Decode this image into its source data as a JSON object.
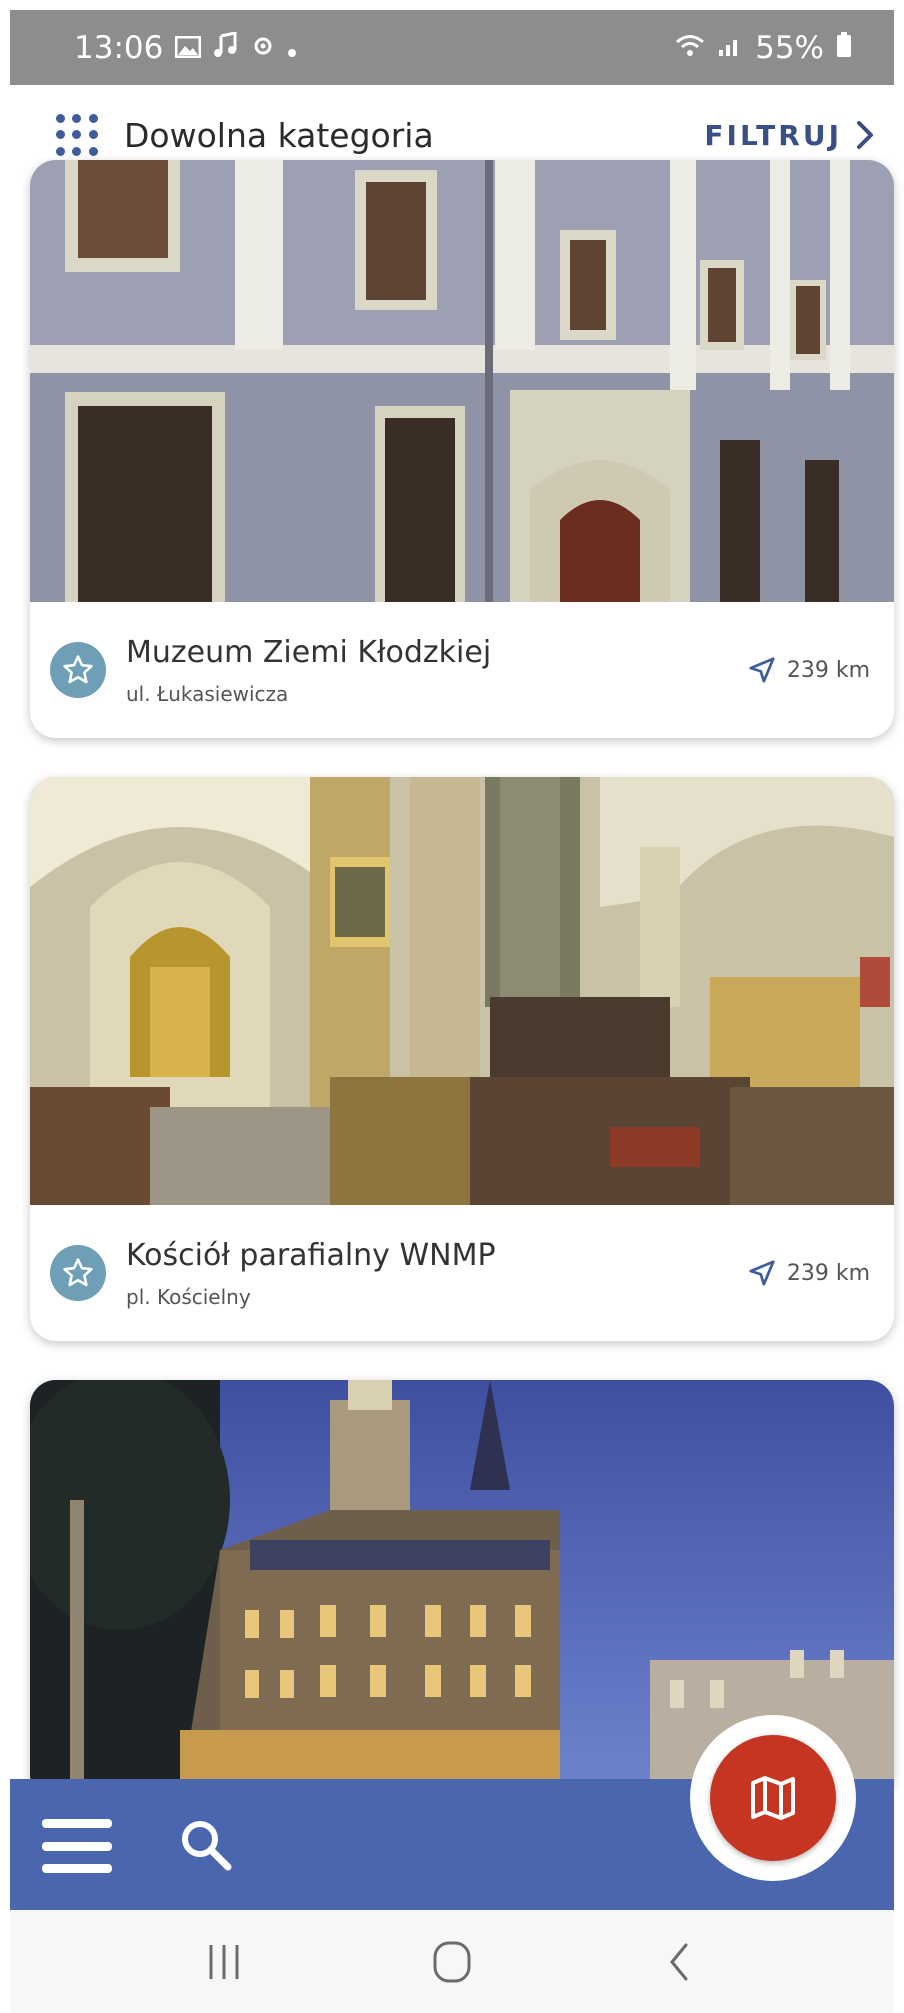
{
  "status_bar": {
    "time": "13:06",
    "battery": "55%"
  },
  "header": {
    "category": "Dowolna kategoria",
    "filter_label": "FILTRUJ"
  },
  "places": [
    {
      "name": "Muzeum Ziemi Kłodzkiej",
      "street": "ul. Łukasiewicza",
      "distance": "239 km"
    },
    {
      "name": "Kościół parafialny WNMP",
      "street": "pl. Kościelny",
      "distance": "239 km"
    },
    {
      "name": "",
      "street": "",
      "distance": ""
    }
  ],
  "colors": {
    "accent": "#4a66ae",
    "fab": "#c63522",
    "favorite": "#6f9fb7",
    "filter_text": "#3a4f86"
  },
  "icons": [
    "grid-icon",
    "chevron-right-icon",
    "star-icon",
    "navigation-arrow-icon",
    "menu-icon",
    "search-icon",
    "map-icon"
  ]
}
